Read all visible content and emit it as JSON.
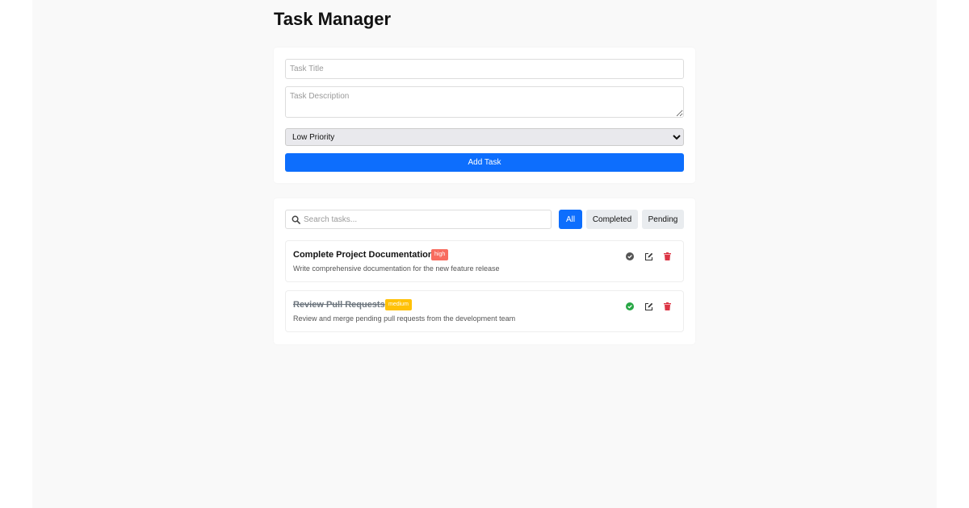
{
  "app": {
    "title": "Task Manager"
  },
  "form": {
    "title_placeholder": "Task Title",
    "description_placeholder": "Task Description",
    "priority_selected": "Low Priority",
    "add_label": "Add Task"
  },
  "search": {
    "placeholder": "Search tasks..."
  },
  "filters": {
    "all": "All",
    "completed": "Completed",
    "pending": "Pending",
    "active": "All"
  },
  "tasks": [
    {
      "title": "Complete Project Documentation",
      "priority": "high",
      "description": "Write comprehensive documentation for the new feature release",
      "completed": false
    },
    {
      "title": "Review Pull Requests",
      "priority": "medium",
      "description": "Review and merge pending pull requests from the development team",
      "completed": true
    }
  ],
  "colors": {
    "accent": "#0d6efd",
    "high": "#f86c5f",
    "medium": "#ffc107",
    "complete": "#28a745",
    "delete": "#dc3545"
  },
  "icons": {
    "search": "search-icon",
    "check": "check-circle-icon",
    "edit": "edit-icon",
    "delete": "trash-icon"
  }
}
